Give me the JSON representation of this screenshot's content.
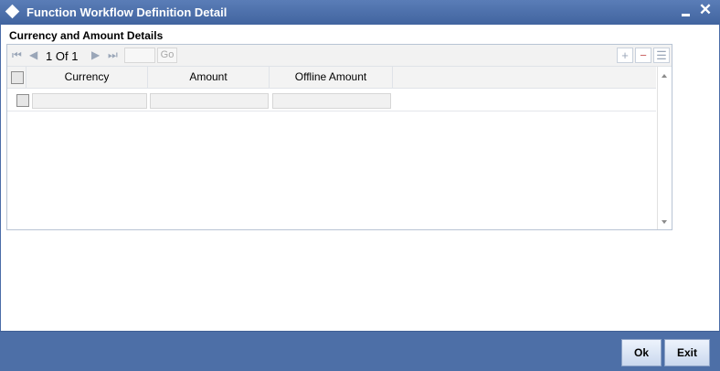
{
  "window": {
    "title": "Function Workflow Definition Detail",
    "minimize_icon": "minimize-icon",
    "close_icon": "close-icon"
  },
  "section": {
    "title": "Currency and Amount Details"
  },
  "grid": {
    "pager": {
      "current_page": "1",
      "of_label": "Of",
      "total_pages": "1",
      "go_label": "Go"
    },
    "toolbar_icons": [
      "add-row-icon",
      "delete-row-icon",
      "single-record-view-icon"
    ],
    "columns": [
      "Currency",
      "Amount",
      "Offline Amount"
    ],
    "rows": [
      {
        "currency": "",
        "amount": "",
        "offline_amount": ""
      }
    ]
  },
  "footer": {
    "ok_label": "Ok",
    "exit_label": "Exit"
  },
  "colors": {
    "title_bar": "#4f72ad",
    "footer_bar": "#4d6fa7",
    "grid_border": "#b8c4d4"
  }
}
